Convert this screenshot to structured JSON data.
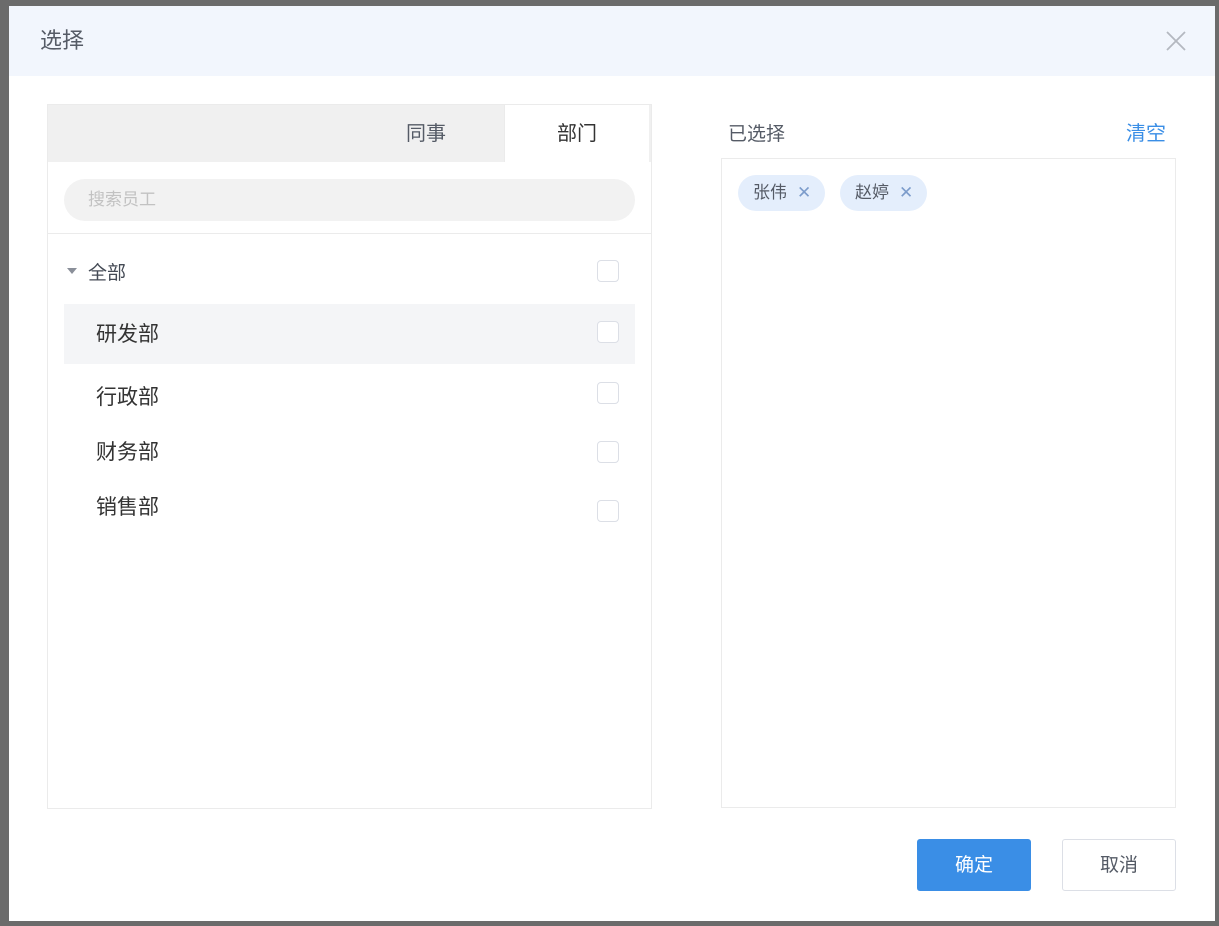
{
  "dialog": {
    "title": "选择",
    "close_icon": "close-icon"
  },
  "tabs": [
    {
      "label": "同事",
      "active": false
    },
    {
      "label": "部门",
      "active": true
    }
  ],
  "search": {
    "placeholder": "搜索员工",
    "value": ""
  },
  "tree": {
    "root": {
      "label": "全部",
      "expanded": true,
      "checked": false
    },
    "children": [
      {
        "label": "研发部",
        "checked": false,
        "highlighted": true
      },
      {
        "label": "行政部",
        "checked": false,
        "highlighted": false
      },
      {
        "label": "财务部",
        "checked": false,
        "highlighted": false
      },
      {
        "label": "销售部",
        "checked": false,
        "highlighted": false
      }
    ]
  },
  "selected": {
    "title": "已选择",
    "clear_label": "清空",
    "items": [
      {
        "name": "张伟"
      },
      {
        "name": "赵婷"
      }
    ]
  },
  "footer": {
    "confirm_label": "确定",
    "cancel_label": "取消"
  },
  "colors": {
    "accent": "#3a8ee6",
    "tag_bg": "#e4eefc",
    "header_bg": "#f2f6fd"
  }
}
